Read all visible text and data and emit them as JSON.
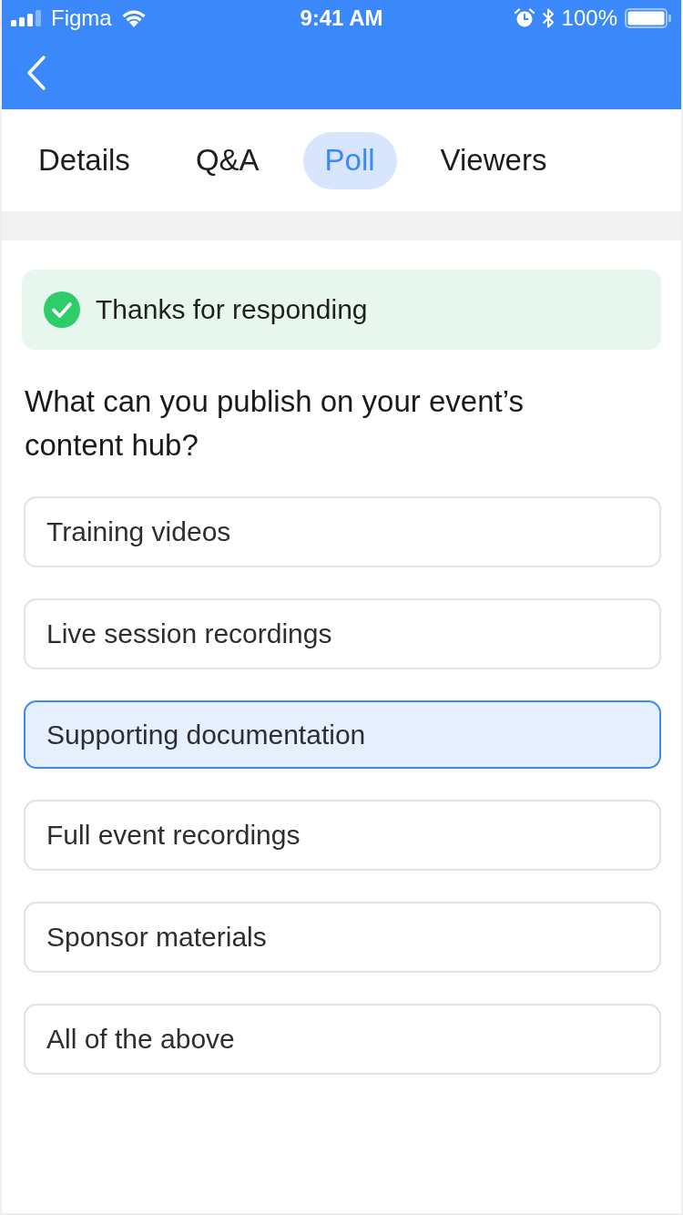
{
  "status_bar": {
    "carrier": "Figma",
    "time": "9:41 AM",
    "battery": "100%"
  },
  "tabs": [
    {
      "label": "Details",
      "selected": false
    },
    {
      "label": "Q&A",
      "selected": false
    },
    {
      "label": "Poll",
      "selected": true
    },
    {
      "label": "Viewers",
      "selected": false
    }
  ],
  "banner": {
    "text": "Thanks for responding"
  },
  "poll": {
    "question": "What can you publish on your event’s content hub?",
    "options": [
      {
        "label": "Training videos",
        "selected": false
      },
      {
        "label": "Live session recordings",
        "selected": false
      },
      {
        "label": "Supporting documentation",
        "selected": true
      },
      {
        "label": "Full event recordings",
        "selected": false
      },
      {
        "label": "Sponsor materials",
        "selected": false
      },
      {
        "label": "All of the above",
        "selected": false
      }
    ]
  }
}
